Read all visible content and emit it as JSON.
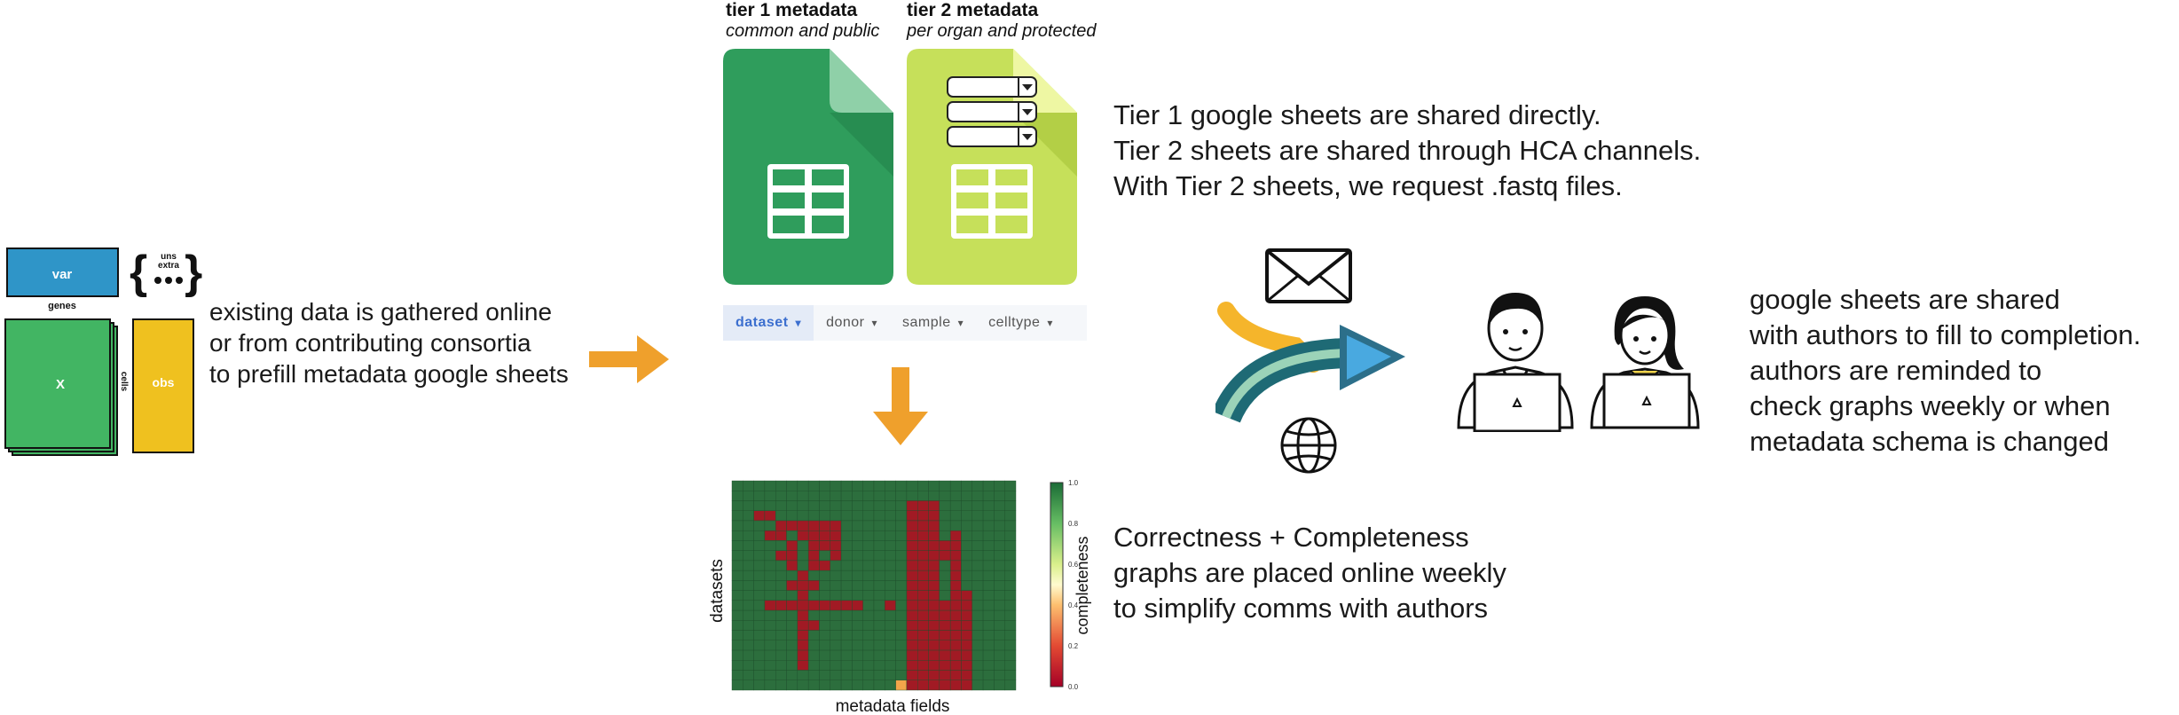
{
  "anndata": {
    "var_label": "var",
    "genes_label": "genes",
    "x_label": "X",
    "cells_label": "cells",
    "obs_label": "obs",
    "uns_label": "uns",
    "extra_label": "extra",
    "colors": {
      "var": "#2f95c8",
      "x": "#42b563",
      "obs": "#efc11f"
    }
  },
  "step1_caption": [
    "existing data is gathered online",
    "or from contributing consortia",
    "to prefill metadata google sheets"
  ],
  "tier1": {
    "title": "tier 1 metadata",
    "subtitle": "common and public",
    "color": "#2f9d5c"
  },
  "tier2": {
    "title": "tier 2 metadata",
    "subtitle": "per organ and protected",
    "color": "#c6e05a"
  },
  "sheet_tabs": [
    "dataset",
    "donor",
    "sample",
    "celltype"
  ],
  "active_tab": "dataset",
  "sharing_caption": [
    "Tier 1 google sheets are shared directly.",
    "Tier 2 sheets are shared through HCA channels.",
    "With Tier 2 sheets, we request .fastq files."
  ],
  "authors_caption": [
    "google sheets are shared",
    "with authors to fill to completion.",
    "authors are reminded to",
    "check graphs weekly or when",
    "metadata schema is changed"
  ],
  "heatmap_caption": [
    "Correctness + Completeness",
    "graphs are placed online weekly",
    "to simplify comms with authors"
  ],
  "heatmap": {
    "ylabel": "datasets",
    "xlabel": "metadata fields",
    "colorbar_label": "completeness",
    "colorbar_ticks": [
      "0.0",
      "0.2",
      "0.4",
      "0.6",
      "0.8",
      "1.0"
    ],
    "rows": 21,
    "cols": 26,
    "cells_red": [
      [
        2,
        16
      ],
      [
        2,
        17
      ],
      [
        2,
        18
      ],
      [
        3,
        2
      ],
      [
        3,
        3
      ],
      [
        3,
        16
      ],
      [
        3,
        17
      ],
      [
        3,
        18
      ],
      [
        4,
        4
      ],
      [
        4,
        5
      ],
      [
        4,
        6
      ],
      [
        4,
        7
      ],
      [
        4,
        8
      ],
      [
        4,
        9
      ],
      [
        4,
        16
      ],
      [
        4,
        17
      ],
      [
        4,
        18
      ],
      [
        5,
        3
      ],
      [
        5,
        4
      ],
      [
        5,
        6
      ],
      [
        5,
        7
      ],
      [
        5,
        8
      ],
      [
        5,
        9
      ],
      [
        5,
        16
      ],
      [
        5,
        17
      ],
      [
        5,
        18
      ],
      [
        5,
        20
      ],
      [
        6,
        5
      ],
      [
        6,
        7
      ],
      [
        6,
        8
      ],
      [
        6,
        9
      ],
      [
        6,
        16
      ],
      [
        6,
        17
      ],
      [
        6,
        18
      ],
      [
        6,
        19
      ],
      [
        6,
        20
      ],
      [
        7,
        4
      ],
      [
        7,
        5
      ],
      [
        7,
        7
      ],
      [
        7,
        9
      ],
      [
        7,
        16
      ],
      [
        7,
        17
      ],
      [
        7,
        18
      ],
      [
        7,
        19
      ],
      [
        7,
        20
      ],
      [
        8,
        5
      ],
      [
        8,
        7
      ],
      [
        8,
        8
      ],
      [
        8,
        16
      ],
      [
        8,
        17
      ],
      [
        8,
        18
      ],
      [
        8,
        20
      ],
      [
        9,
        6
      ],
      [
        9,
        16
      ],
      [
        9,
        17
      ],
      [
        9,
        18
      ],
      [
        9,
        20
      ],
      [
        10,
        5
      ],
      [
        10,
        6
      ],
      [
        10,
        7
      ],
      [
        10,
        16
      ],
      [
        10,
        17
      ],
      [
        10,
        18
      ],
      [
        10,
        20
      ],
      [
        11,
        6
      ],
      [
        11,
        16
      ],
      [
        11,
        17
      ],
      [
        11,
        18
      ],
      [
        11,
        20
      ],
      [
        11,
        21
      ],
      [
        12,
        3
      ],
      [
        12,
        4
      ],
      [
        12,
        5
      ],
      [
        12,
        6
      ],
      [
        12,
        7
      ],
      [
        12,
        8
      ],
      [
        12,
        9
      ],
      [
        12,
        10
      ],
      [
        12,
        11
      ],
      [
        12,
        14
      ],
      [
        12,
        16
      ],
      [
        12,
        17
      ],
      [
        12,
        18
      ],
      [
        12,
        19
      ],
      [
        12,
        20
      ],
      [
        12,
        21
      ],
      [
        13,
        6
      ],
      [
        13,
        16
      ],
      [
        13,
        17
      ],
      [
        13,
        18
      ],
      [
        13,
        19
      ],
      [
        13,
        20
      ],
      [
        13,
        21
      ],
      [
        14,
        6
      ],
      [
        14,
        7
      ],
      [
        14,
        16
      ],
      [
        14,
        17
      ],
      [
        14,
        18
      ],
      [
        14,
        19
      ],
      [
        14,
        20
      ],
      [
        14,
        21
      ],
      [
        15,
        6
      ],
      [
        15,
        16
      ],
      [
        15,
        17
      ],
      [
        15,
        18
      ],
      [
        15,
        19
      ],
      [
        15,
        20
      ],
      [
        15,
        21
      ],
      [
        16,
        6
      ],
      [
        16,
        16
      ],
      [
        16,
        17
      ],
      [
        16,
        18
      ],
      [
        16,
        19
      ],
      [
        16,
        20
      ],
      [
        16,
        21
      ],
      [
        17,
        6
      ],
      [
        17,
        16
      ],
      [
        17,
        17
      ],
      [
        17,
        18
      ],
      [
        17,
        19
      ],
      [
        17,
        20
      ],
      [
        17,
        21
      ],
      [
        18,
        6
      ],
      [
        18,
        16
      ],
      [
        18,
        17
      ],
      [
        18,
        18
      ],
      [
        18,
        19
      ],
      [
        18,
        20
      ],
      [
        18,
        21
      ],
      [
        19,
        16
      ],
      [
        19,
        17
      ],
      [
        19,
        18
      ],
      [
        19,
        19
      ],
      [
        19,
        20
      ],
      [
        19,
        21
      ],
      [
        20,
        16
      ],
      [
        20,
        17
      ],
      [
        20,
        18
      ],
      [
        20,
        19
      ],
      [
        20,
        20
      ],
      [
        20,
        21
      ]
    ],
    "cells_orange": [
      [
        20,
        15
      ]
    ],
    "colors": {
      "green": "#2c6e3d",
      "red": "#a11a24",
      "orange": "#f2a54a"
    }
  },
  "arrow_color": "#efa02c"
}
